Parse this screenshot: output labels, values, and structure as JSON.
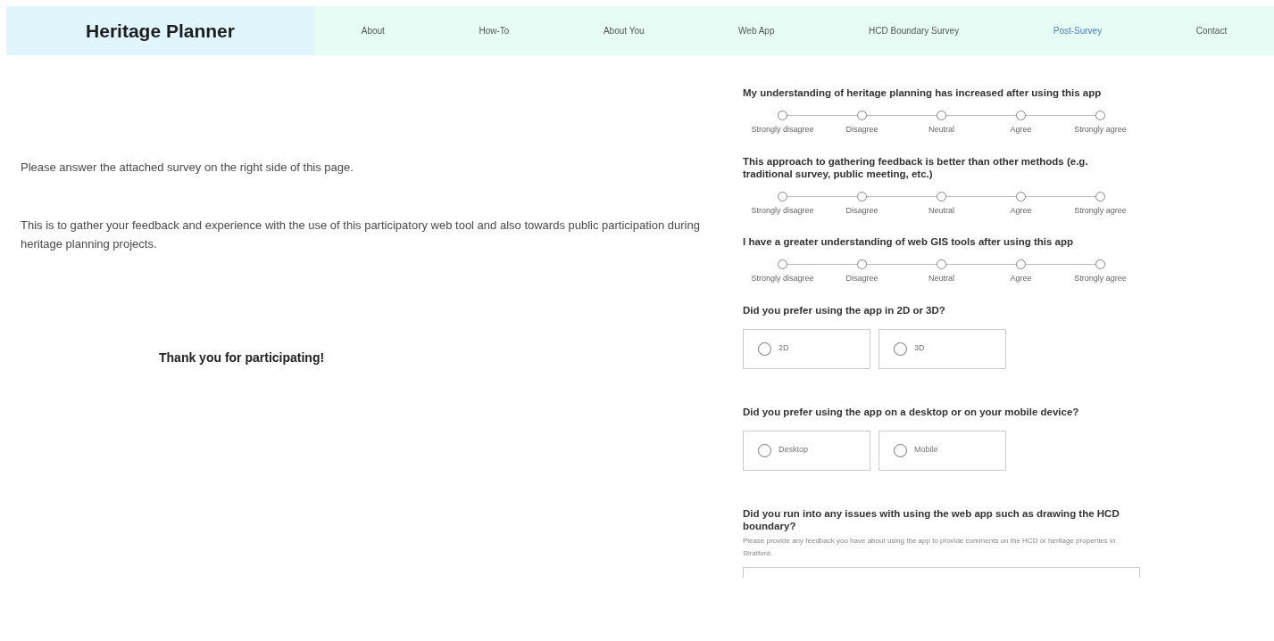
{
  "header": {
    "title": "Heritage Planner",
    "nav": [
      {
        "label": "About",
        "selected": false
      },
      {
        "label": "How-To",
        "selected": false
      },
      {
        "label": "About You",
        "selected": false
      },
      {
        "label": "Web App",
        "selected": false
      },
      {
        "label": "HCD Boundary Survey",
        "selected": false
      },
      {
        "label": "Post-Survey",
        "selected": true
      },
      {
        "label": "Contact",
        "selected": false
      }
    ]
  },
  "intro": {
    "paragraphs": [
      "Please answer the attached survey on the right side of this page.",
      "This is to gather your feedback and experience with the use of this participatory web tool and also towards public participation during heritage planning projects."
    ],
    "thanks": "Thank you for participating!"
  },
  "survey": {
    "questions": [
      {
        "kind": "likert",
        "title": "My understanding of heritage planning has increased after using this app",
        "options": [
          {
            "label": "Strongly disagree",
            "selected": false
          },
          {
            "label": "Disagree",
            "selected": false
          },
          {
            "label": "Neutral",
            "selected": false
          },
          {
            "label": "Agree",
            "selected": false
          },
          {
            "label": "Strongly agree",
            "selected": false
          }
        ]
      },
      {
        "kind": "likert",
        "title": "This approach to gathering feedback is better than other methods (e.g. traditional survey, public meeting, etc.)",
        "options": [
          {
            "label": "Strongly disagree",
            "selected": false
          },
          {
            "label": "Disagree",
            "selected": false
          },
          {
            "label": "Neutral",
            "selected": false
          },
          {
            "label": "Agree",
            "selected": false
          },
          {
            "label": "Strongly agree",
            "selected": false
          }
        ]
      },
      {
        "kind": "likert",
        "title": "I have a greater understanding of web GIS tools after using this app",
        "options": [
          {
            "label": "Strongly disagree",
            "selected": false
          },
          {
            "label": "Disagree",
            "selected": false
          },
          {
            "label": "Neutral",
            "selected": false
          },
          {
            "label": "Agree",
            "selected": false
          },
          {
            "label": "Strongly agree",
            "selected": false
          }
        ]
      },
      {
        "kind": "choice",
        "title": "Did you prefer using the app in 2D or 3D?",
        "options": [
          {
            "label": "2D",
            "selected": false
          },
          {
            "label": "3D",
            "selected": false
          }
        ]
      },
      {
        "kind": "choice",
        "title": "Did you prefer using the app on a desktop or on your mobile device?",
        "options": [
          {
            "label": "Desktop",
            "selected": false
          },
          {
            "label": "Mobile",
            "selected": false
          }
        ]
      },
      {
        "kind": "text",
        "title": "Did you run into any issues with using the web app such as drawing the HCD boundary?",
        "description": "Please provide any feedback you have about using the app to provide comments on the HCD or heritage properties in Stratford."
      }
    ]
  }
}
